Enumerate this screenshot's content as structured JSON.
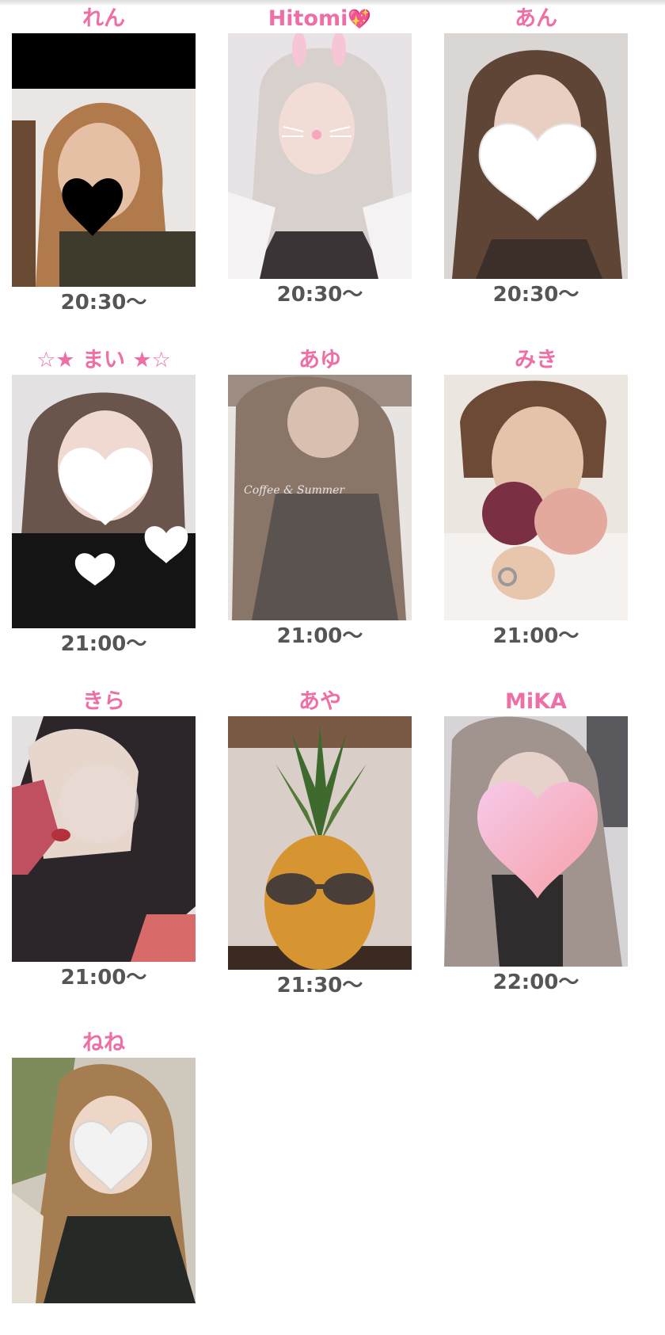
{
  "cast_list": [
    {
      "name": "れん",
      "time": "20:30〜",
      "photo_tone": "#b98a5e",
      "mask": "black-heart"
    },
    {
      "name": "Hitomi",
      "badge": "💖",
      "time": "20:30〜",
      "photo_tone": "#cfc6c2",
      "mask": "bunny-filter"
    },
    {
      "name": "あん",
      "time": "20:30〜",
      "photo_tone": "#8a6b5a",
      "mask": "white-heart"
    },
    {
      "name": "☆★ まい ★☆",
      "time": "21:00〜",
      "photo_tone": "#5b4a45",
      "mask": "white-hearts"
    },
    {
      "name": "あゆ",
      "time": "21:00〜",
      "photo_tone": "#9a8b80",
      "mask": "none"
    },
    {
      "name": "みき",
      "time": "21:00〜",
      "photo_tone": "#c7a98f",
      "mask": "mask-prop"
    },
    {
      "name": "きら",
      "time": "21:00〜",
      "photo_tone": "#5d4a4a",
      "mask": "glitter"
    },
    {
      "name": "あや",
      "time": "21:30〜",
      "photo_tone": "#d39a3a",
      "mask": "pineapple"
    },
    {
      "name": "MiKA",
      "time": "22:00〜",
      "photo_tone": "#a89a96",
      "mask": "pink-heart"
    },
    {
      "name": "ねね",
      "time": "",
      "photo_tone": "#a98a62",
      "mask": "white-heart"
    }
  ],
  "colors": {
    "name_pink": "#ee6fa6",
    "time_gray": "#555555"
  }
}
